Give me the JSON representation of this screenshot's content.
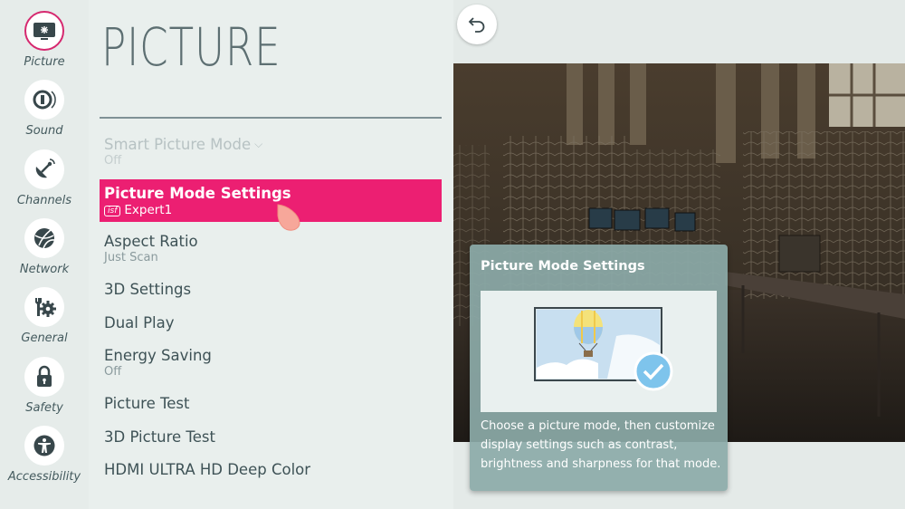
{
  "nav": [
    {
      "id": "picture",
      "label": "Picture",
      "active": true
    },
    {
      "id": "sound",
      "label": "Sound",
      "active": false
    },
    {
      "id": "channels",
      "label": "Channels",
      "active": false
    },
    {
      "id": "network",
      "label": "Network",
      "active": false
    },
    {
      "id": "general",
      "label": "General",
      "active": false
    },
    {
      "id": "safety",
      "label": "Safety",
      "active": false
    },
    {
      "id": "accessibility",
      "label": "Accessibility",
      "active": false
    }
  ],
  "menu": {
    "title": "PICTURE",
    "items": [
      {
        "label": "Smart Picture Mode",
        "value": "Off",
        "disabled": true,
        "dropdown": true
      },
      {
        "label": "Picture Mode Settings",
        "value": "Expert1",
        "badge": "isf",
        "selected": true
      },
      {
        "label": "Aspect Ratio",
        "value": "Just Scan"
      },
      {
        "label": "3D Settings",
        "value": ""
      },
      {
        "label": "Dual Play",
        "value": ""
      },
      {
        "label": "Energy Saving",
        "value": "Off"
      },
      {
        "label": "Picture Test",
        "value": ""
      },
      {
        "label": "3D Picture Test",
        "value": ""
      },
      {
        "label": "HDMI ULTRA HD Deep Color",
        "value": ""
      }
    ]
  },
  "info_card": {
    "title": "Picture Mode Settings",
    "description": "Choose a picture mode, then customize display settings such as contrast, brightness and sharpness for that mode."
  },
  "icons": {
    "back": "back-arrow-icon",
    "picture": "picture-settings-icon",
    "sound": "sound-icon",
    "channels": "channels-icon",
    "network": "network-globe-icon",
    "general": "general-wrench-gear-icon",
    "safety": "lock-icon",
    "accessibility": "accessibility-person-icon"
  },
  "colors": {
    "accent": "#ec1f72",
    "panel_bg": "#e9efed",
    "text": "#3e5256",
    "card_bg": "#8caaa8"
  }
}
